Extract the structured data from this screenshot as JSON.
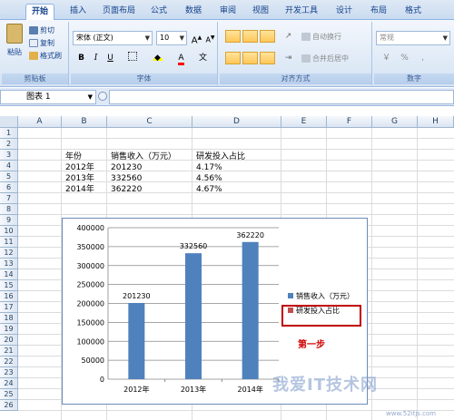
{
  "tabs": [
    "开始",
    "插入",
    "页面布局",
    "公式",
    "数据",
    "审阅",
    "视图",
    "开发工具",
    "设计",
    "布局",
    "格式"
  ],
  "ribbon": {
    "clipboard": {
      "paste": "粘贴",
      "cut": "剪切",
      "copy": "复制",
      "format_painter": "格式刷",
      "label": "剪贴板"
    },
    "font": {
      "name": "宋体 (正文)",
      "size": "10",
      "label": "字体"
    },
    "alignment": {
      "wrap": "自动换行",
      "merge": "合并后居中",
      "label": "对齐方式"
    },
    "number": {
      "format": "常规",
      "label": "数字"
    }
  },
  "formula_bar": {
    "name_box": "图表 1"
  },
  "columns": [
    "A",
    "B",
    "C",
    "D",
    "E",
    "F",
    "G",
    "H"
  ],
  "rows": [
    "1",
    "2",
    "3",
    "4",
    "5",
    "6",
    "7",
    "8",
    "9",
    "10",
    "11",
    "12",
    "13",
    "14",
    "15",
    "16",
    "17",
    "18",
    "19",
    "20",
    "21",
    "22",
    "23",
    "24",
    "25",
    "26"
  ],
  "table": {
    "headers": [
      "年份",
      "销售收入（万元）",
      "研发投入占比"
    ],
    "rows": [
      [
        "2012年",
        "201230",
        "4.17%"
      ],
      [
        "2013年",
        "332560",
        "4.56%"
      ],
      [
        "2014年",
        "362220",
        "4.67%"
      ]
    ]
  },
  "chart_data": {
    "type": "bar",
    "categories": [
      "2012年",
      "2013年",
      "2014年"
    ],
    "series": [
      {
        "name": "销售收入（万元）",
        "values": [
          201230,
          332560,
          362220
        ],
        "color": "#4f81bd"
      },
      {
        "name": "研发投入占比",
        "values": [
          4.17,
          4.56,
          4.67
        ],
        "color": "#c0504d"
      }
    ],
    "data_labels": [
      "201230",
      "332560",
      "362220"
    ],
    "ylim": [
      0,
      400000
    ],
    "yticks": [
      "400000",
      "350000",
      "300000",
      "250000",
      "200000",
      "150000",
      "100000",
      "50000",
      "0"
    ],
    "grid": true,
    "legend": "right"
  },
  "annotation": "第一步",
  "watermark": "我爱IT技术网",
  "watermark_url": "www.52itjs.com"
}
